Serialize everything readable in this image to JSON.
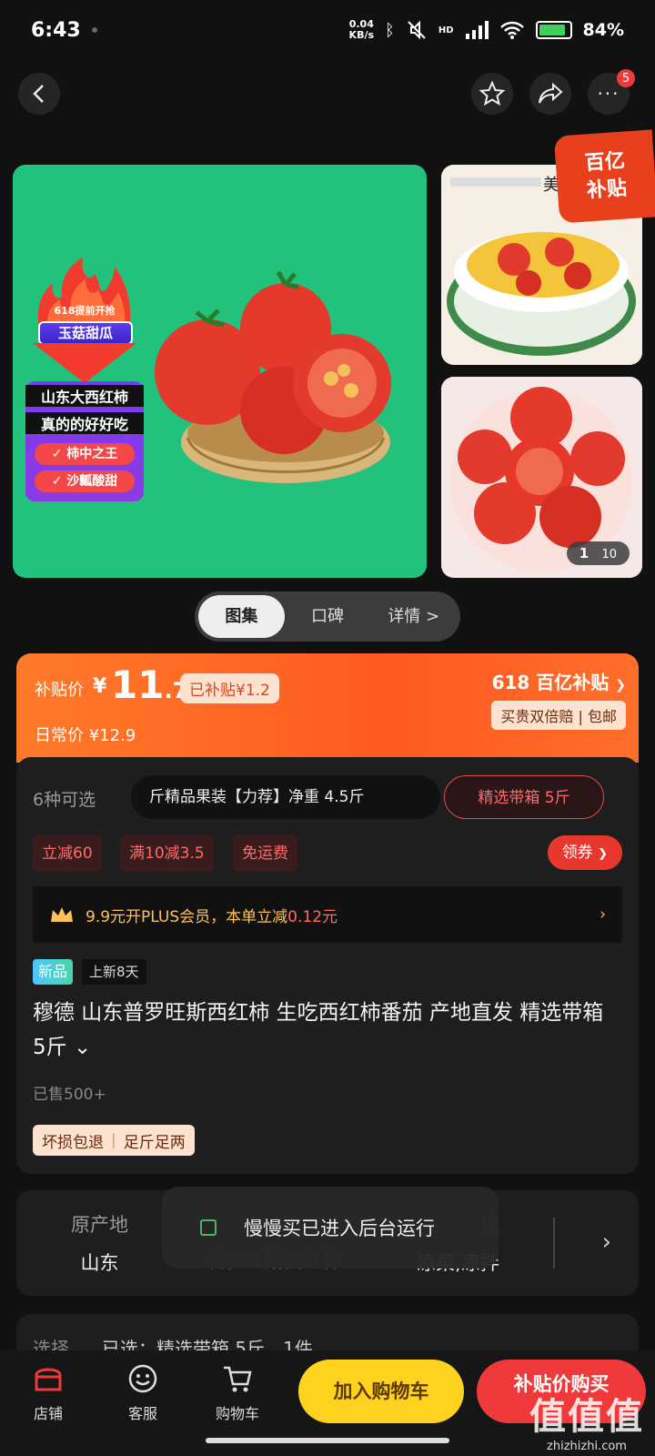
{
  "status": {
    "time": "6:43",
    "speed_value": "0.04",
    "speed_unit": "KB/s",
    "network": "HD",
    "battery": "84%"
  },
  "nav": {
    "cart_badge": "5"
  },
  "gallery": {
    "promo": {
      "tag": "618提前开抢",
      "title": "玉菇甜瓜",
      "line1": "山东大西红柿",
      "line2": "真的的好好吃",
      "pill1": "柿中之王",
      "pill2": "沙瓤酸甜"
    },
    "thumb1_caption": "美",
    "subsidy_corner": [
      "百亿",
      "补贴"
    ],
    "counter_current": "1",
    "counter_total": "10",
    "tabs": [
      "图集",
      "口碑",
      "详情 >"
    ]
  },
  "price": {
    "label": "补贴价",
    "yen": "¥",
    "integer": "11",
    "decimal": ".7",
    "subsidized": "已补贴¥1.2",
    "daily": "日常价 ¥12.9",
    "brand": "618 百亿补贴",
    "guarantee": "买贵双倍赔 | 包邮"
  },
  "product": {
    "option_count": "6种可选",
    "spec1": "斤精品果装【力荐】净重 4.5斤",
    "spec2": "精选带箱 5斤",
    "coupons": [
      "立减60",
      "满10减3.5",
      "免运费"
    ],
    "get_coupon": "领券",
    "plus": {
      "pre": "9.9元开PLUS会员，本单立减",
      "amount": "0.12元"
    },
    "new_tag": "新品",
    "new_days": "上新8天",
    "title": "穆德 山东普罗旺斯西红柿 生吃西红柿番茄 产地直发 精选带箱 5斤 ⌄",
    "sold": "已售500+",
    "services": [
      "坏损包退",
      "足斤足两"
    ]
  },
  "attrs": {
    "origin_label": "原产地",
    "origin_value": "山东",
    "variety_partial": "普罗旺斯西红柿",
    "usage_label_partial": "议",
    "usage_value": "凉菜,凉拌"
  },
  "toast": "慢慢买已进入后台运行",
  "choose": {
    "label": "选择",
    "selected": "已选：精选带箱 5斤，1件"
  },
  "bottom": {
    "store": "店铺",
    "service": "客服",
    "cart": "购物车",
    "add_cart": "加入购物车",
    "buy": "补贴价购买"
  },
  "watermark": {
    "big": "值值值",
    "small": "zhizhizhi.com"
  },
  "colors": {
    "accent_orange": "#ff5a1f",
    "buy_red": "#f0393a",
    "cart_yellow": "#ffd21f",
    "gallery_green": "#23c27c"
  }
}
